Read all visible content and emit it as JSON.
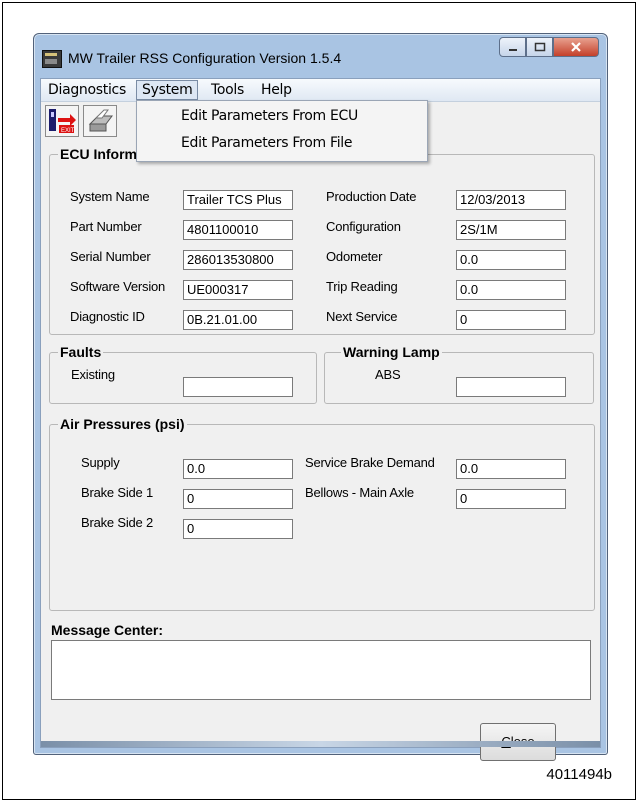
{
  "window": {
    "title": "MW Trailer RSS Configuration  Version 1.5.4"
  },
  "menu": {
    "diagnostics": "Diagnostics",
    "system": "System",
    "tools": "Tools",
    "help": "Help"
  },
  "system_menu": {
    "from_ecu": "Edit Parameters From ECU",
    "from_file": "Edit Parameters From File"
  },
  "toolbar": {
    "exit_label": "EXIT"
  },
  "ecu": {
    "title": "ECU Information",
    "system_name_label": "System Name",
    "system_name": "Trailer TCS Plus",
    "part_number_label": "Part Number",
    "part_number": "4801100010",
    "serial_number_label": "Serial Number",
    "serial_number": "286013530800",
    "software_version_label": "Software Version",
    "software_version": "UE000317",
    "diagnostic_id_label": "Diagnostic ID",
    "diagnostic_id": "0B.21.01.00",
    "production_date_label": "Production Date",
    "production_date": "12/03/2013",
    "configuration_label": "Configuration",
    "configuration": "2S/1M",
    "odometer_label": "Odometer",
    "odometer": "0.0",
    "trip_reading_label": "Trip Reading",
    "trip_reading": "0.0",
    "next_service_label": "Next Service",
    "next_service": "0"
  },
  "faults": {
    "title": "Faults",
    "existing_label": "Existing",
    "existing": ""
  },
  "warning_lamp": {
    "title": "Warning Lamp",
    "abs_label": "ABS",
    "abs": ""
  },
  "air": {
    "title": "Air Pressures (psi)",
    "supply_label": "Supply",
    "supply": "0.0",
    "brake_side1_label": "Brake Side 1",
    "brake_side1": "0",
    "brake_side2_label": "Brake Side 2",
    "brake_side2": "0",
    "service_brake_label": "Service Brake Demand",
    "service_brake": "0.0",
    "bellows_label": "Bellows - Main Axle",
    "bellows": "0"
  },
  "message_center": {
    "label": "Message Center:",
    "text": ""
  },
  "buttons": {
    "close_first": "C",
    "close_rest": "lose"
  },
  "figure_id": "4011494b"
}
